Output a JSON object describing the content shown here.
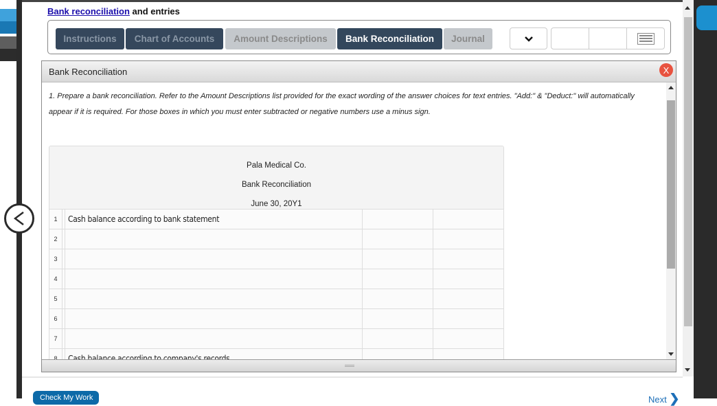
{
  "page": {
    "title_link": "Bank reconciliation",
    "title_rest": " and entries"
  },
  "tabs": [
    {
      "label": "Instructions",
      "state": "dark"
    },
    {
      "label": "Chart of Accounts",
      "state": "dark"
    },
    {
      "label": "Amount Descriptions",
      "state": "light"
    },
    {
      "label": "Bank Reconciliation",
      "state": "active"
    },
    {
      "label": "Journal",
      "state": "light"
    }
  ],
  "toolbar": {
    "dropdown_icon": "chevron-down-icon",
    "menu_icon": "list-icon"
  },
  "panel": {
    "title": "Bank Reconciliation",
    "close_label": "X",
    "instructions": "1. Prepare a bank reconciliation. Refer to the Amount Descriptions list provided for the exact wording of the answer choices for text entries. \"Add:\" & \"Deduct:\" will automatically appear if it is required. For those boxes in which you must enter subtracted or negative numbers use a minus sign."
  },
  "table": {
    "company": "Pala Medical Co.",
    "report": "Bank Reconciliation",
    "date": "June 30, 20Y1",
    "rows": [
      {
        "num": "1",
        "label": "Cash balance according to bank statement",
        "col1": "",
        "col2": ""
      },
      {
        "num": "2",
        "label": "",
        "col1": "",
        "col2": ""
      },
      {
        "num": "3",
        "label": "",
        "col1": "",
        "col2": ""
      },
      {
        "num": "4",
        "label": "",
        "col1": "",
        "col2": ""
      },
      {
        "num": "5",
        "label": "",
        "col1": "",
        "col2": ""
      },
      {
        "num": "6",
        "label": "",
        "col1": "",
        "col2": ""
      },
      {
        "num": "7",
        "label": "",
        "col1": "",
        "col2": ""
      },
      {
        "num": "8",
        "label": "Cash balance according to company's records",
        "col1": "",
        "col2": ""
      }
    ]
  },
  "footer": {
    "check_label": "Check My Work",
    "next_label": "Next"
  },
  "colors": {
    "tab_dark": "#35475c",
    "tab_light": "#c4c8cc",
    "close_red": "#e8523f",
    "check_blue": "#0d6aa8"
  }
}
